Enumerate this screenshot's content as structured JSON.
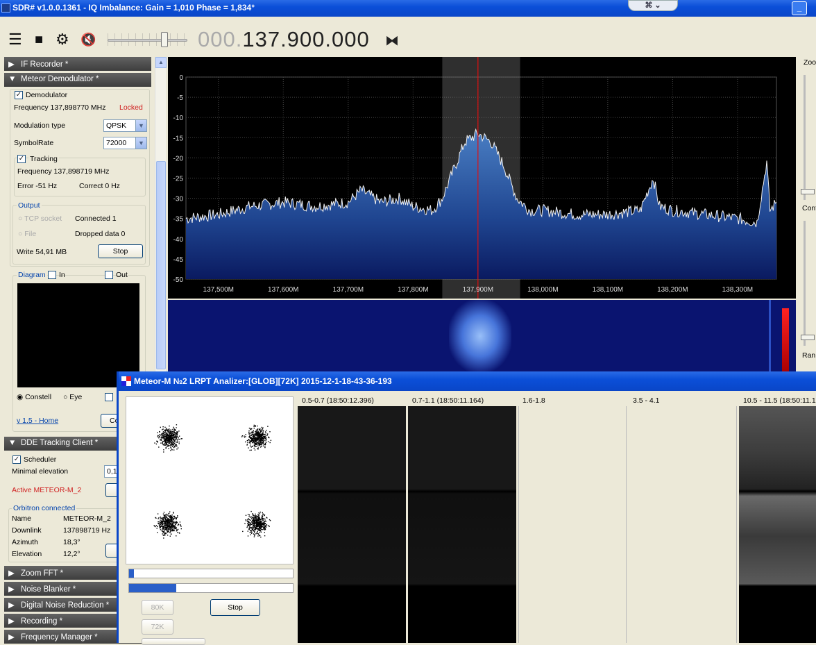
{
  "window": {
    "title": "SDR# v1.0.0.1361 - IQ Imbalance: Gain = 1,010 Phase = 1,834°"
  },
  "toolbar": {
    "menu_icon": "hamburger-icon",
    "stop_icon": "stop-icon",
    "settings_icon": "gear-icon",
    "mute_icon": "speaker-muted-icon",
    "freq_dim": "000.",
    "freq_main": "137.900.000",
    "tune_icon": "tune-arrows-icon"
  },
  "sidebar": {
    "if_recorder": "IF Recorder *",
    "meteor_demod": "Meteor Demodulator *",
    "demodulator_label": "Demodulator",
    "frequency_text": "Frequency 137,898770 MHz",
    "locked": "Locked",
    "modulation_type_label": "Modulation type",
    "modulation_type_value": "QPSK",
    "symbolrate_label": "SymbolRate",
    "symbolrate_value": "72000",
    "tracking_label": "Tracking",
    "tracking_freq": "Frequency 137,898719 MHz",
    "error": "Error -51 Hz",
    "correct": "Correct 0 Hz",
    "output_label": "Output",
    "tcp_socket": "TCP socket",
    "connected": "Connected 1",
    "file": "File",
    "dropped": "Dropped data 0",
    "write": "Write 54,91 MB",
    "stop_button": "Stop",
    "diagram_label": "Diagram",
    "in_label": "In",
    "out_label": "Out",
    "constell": "Constell",
    "eye": "Eye",
    "version_link": "v 1.5 - Home",
    "co_button": "Co",
    "dde_tracking": "DDE Tracking Client *",
    "scheduler": "Scheduler",
    "minimal_elevation": "Minimal elevation",
    "min_elev_value": "0,1",
    "active_sat": "Active METEOR-M_2",
    "orbitron": "Orbitron connected",
    "name_label": "Name",
    "name_value": "METEOR-M_2",
    "downlink_label": "Downlink",
    "downlink_value": "137898719 Hz",
    "azimuth_label": "Azimuth",
    "azimuth_value": "18,3°",
    "elevation_label": "Elevation",
    "elevation_value": "12,2°",
    "zoom_fft": "Zoom FFT *",
    "noise_blanker": "Noise Blanker *",
    "dnr": "Digital Noise Reduction *",
    "recording": "Recording *",
    "freq_manager": "Frequency Manager *"
  },
  "right_panel": {
    "zoom": "Zoo",
    "contrast": "Cont",
    "range": "Ran"
  },
  "chart_data": {
    "type": "line",
    "yticks": [
      "0",
      "-5",
      "-10",
      "-15",
      "-20",
      "-25",
      "-30",
      "-35",
      "-40",
      "-45",
      "-50"
    ],
    "ylim": [
      -50,
      0
    ],
    "xlim": [
      137.45,
      138.36
    ],
    "xticks": [
      "137,500M",
      "137,600M",
      "137,700M",
      "137,800M",
      "137,900M",
      "138,000M",
      "138,100M",
      "138,200M",
      "138,300M"
    ],
    "xtick_values": [
      137.5,
      137.6,
      137.7,
      137.8,
      137.9,
      138.0,
      138.1,
      138.2,
      138.3
    ],
    "center_mhz": 137.9,
    "filter_band_mhz": [
      137.845,
      137.965
    ],
    "x": [
      137.45,
      137.5,
      137.55,
      137.6,
      137.65,
      137.7,
      137.72,
      137.75,
      137.78,
      137.8,
      137.83,
      137.845,
      137.86,
      137.88,
      137.9,
      137.92,
      137.94,
      137.96,
      137.98,
      138.0,
      138.05,
      138.1,
      138.15,
      138.17,
      138.18,
      138.2,
      138.25,
      138.3,
      138.33,
      138.345,
      138.35,
      138.36
    ],
    "y": [
      -35,
      -34,
      -32,
      -31,
      -32,
      -31,
      -28,
      -31,
      -30,
      -32,
      -33,
      -30,
      -24,
      -16,
      -14,
      -16,
      -22,
      -30,
      -33,
      -33,
      -34,
      -34,
      -33,
      -25,
      -32,
      -33,
      -34,
      -35,
      -36,
      -21,
      -33,
      -31
    ]
  },
  "dialog": {
    "title": "Meteor-M №2 LRPT Analizer:[GLOB][72K] 2015-12-1-18-43-36-193",
    "progress1": 0.03,
    "progress2": 0.29,
    "btn_80k": "80K",
    "btn_72k": "72K",
    "stop": "Stop",
    "channels": [
      "0.5-0.7 (18:50:12.396)",
      "0.7-1.1 (18:50:11.164)",
      "1.6-1.8",
      "3.5 - 4.1",
      "10.5 - 11.5 (18:50:11.16"
    ]
  }
}
